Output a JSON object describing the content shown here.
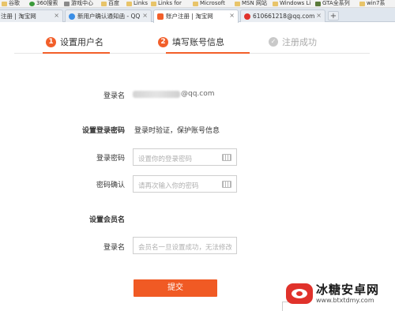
{
  "bookmarks": [
    {
      "label": "谷歌",
      "icon": "folder-icon"
    },
    {
      "label": "360搜索",
      "icon": "360-icon"
    },
    {
      "label": "游戏中心",
      "icon": "gamepad-icon"
    },
    {
      "label": "百度",
      "icon": "folder-icon"
    },
    {
      "label": "Links",
      "icon": "folder-icon"
    },
    {
      "label": "Links for",
      "icon": "folder-icon"
    },
    {
      "label": "Microsoft",
      "icon": "folder-icon"
    },
    {
      "label": "MSN 网站",
      "icon": "folder-icon"
    },
    {
      "label": "Windows Li",
      "icon": "folder-icon"
    },
    {
      "label": "GTA全系列",
      "icon": "gta-icon"
    },
    {
      "label": "win7系",
      "icon": "folder-icon"
    }
  ],
  "tabs": [
    {
      "label": "注册 | 淘宝网",
      "icon_color": "#f25f2a"
    },
    {
      "label": "新用户确认通知函 - QQ",
      "icon_color": "#3a8ee6"
    },
    {
      "label": "账户注册 | 淘宝网",
      "icon_color": "#f25f2a"
    },
    {
      "label": "610661218@qq.com",
      "icon_color": "#e0322b"
    }
  ],
  "tab_new_label": "+",
  "steps": [
    {
      "num": "1",
      "label": "设置用户名"
    },
    {
      "num": "2",
      "label": "填写账号信息"
    },
    {
      "num": "✓",
      "label": "注册成功"
    }
  ],
  "form": {
    "login_name_label": "登录名",
    "login_name_suffix": "@qq.com",
    "set_password_label": "设置登录密码",
    "password_hint": "登录时验证，保护账号信息",
    "password_label": "登录密码",
    "password_placeholder": "设置你的登录密码",
    "confirm_label": "密码确认",
    "confirm_placeholder": "请再次输入你的密码",
    "member_section_label": "设置会员名",
    "member_label": "登录名",
    "member_placeholder": "会员名一旦设置成功，无法修改",
    "submit_label": "提交"
  },
  "colors": {
    "accent": "#f25f2a",
    "submit": "#f05a24"
  },
  "watermark": {
    "title": "冰糖安卓网",
    "url": "www.btxtdmy.com"
  }
}
